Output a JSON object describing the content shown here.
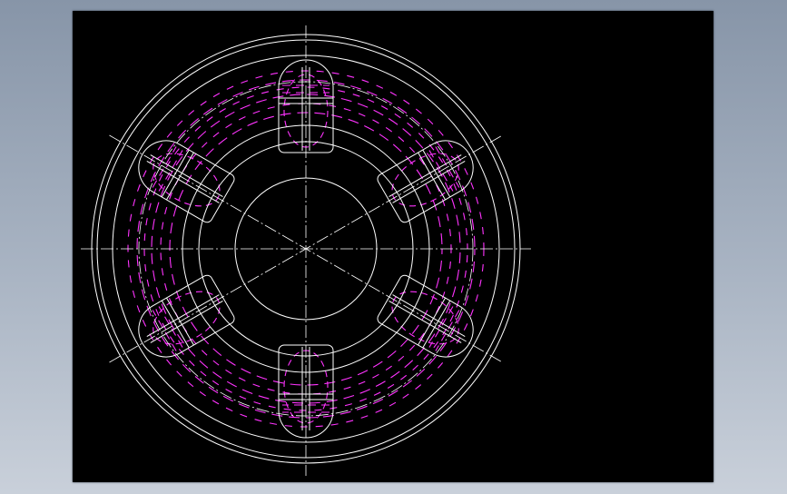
{
  "viewport": {
    "background": "#000000"
  },
  "drawing": {
    "line_color": "#ffffff",
    "hidden_line_color": "#ff33ff",
    "slot_count": 6,
    "slot_angles_deg": [
      90,
      30,
      -30,
      -90,
      -150,
      150
    ]
  }
}
